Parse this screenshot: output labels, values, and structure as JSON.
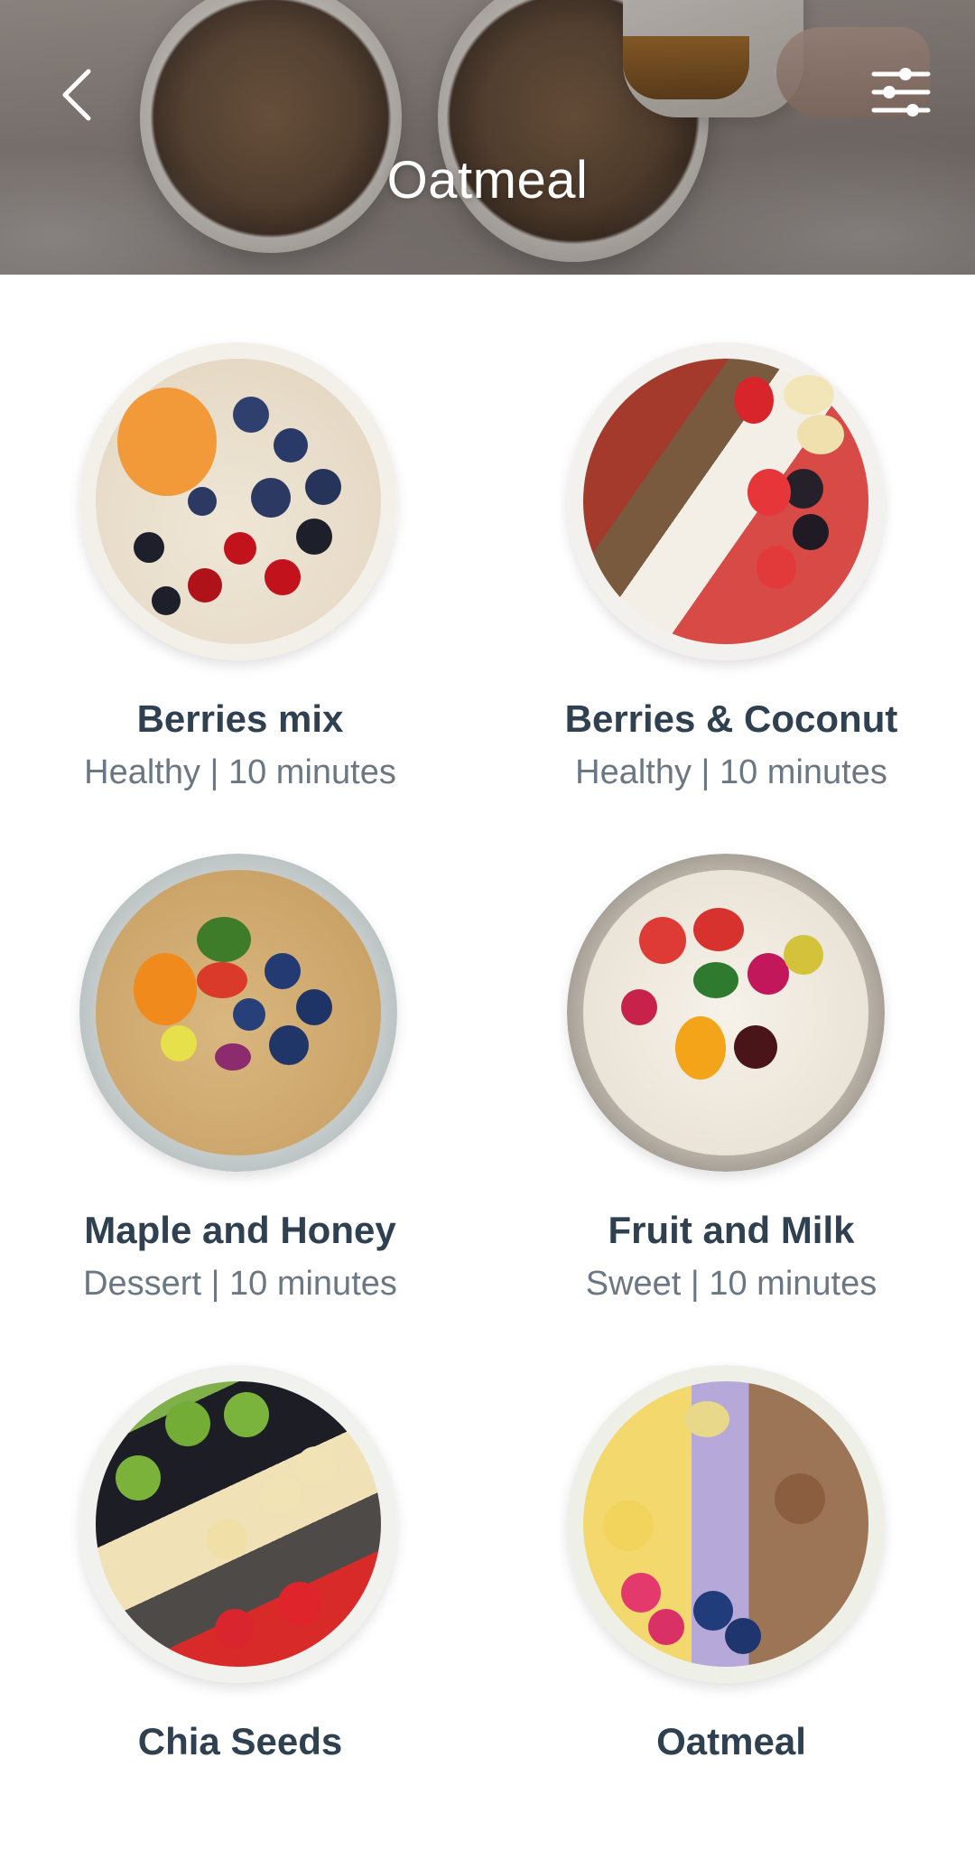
{
  "header": {
    "title": "Oatmeal",
    "back_icon": "chevron-left-icon",
    "filter_icon": "sliders-icon"
  },
  "colors": {
    "title_text": "#ffffff",
    "recipe_name": "#2f4050",
    "recipe_meta": "#6b7883",
    "background": "#ffffff"
  },
  "recipes": [
    {
      "name": "Berries mix",
      "meta": "Healthy | 10 minutes"
    },
    {
      "name": "Berries & Coconut",
      "meta": "Healthy | 10 minutes"
    },
    {
      "name": "Maple and Honey",
      "meta": "Dessert | 10 minutes"
    },
    {
      "name": "Fruit and Milk",
      "meta": "Sweet | 10 minutes"
    },
    {
      "name": "Chia Seeds",
      "meta": ""
    },
    {
      "name": "Oatmeal",
      "meta": ""
    }
  ]
}
